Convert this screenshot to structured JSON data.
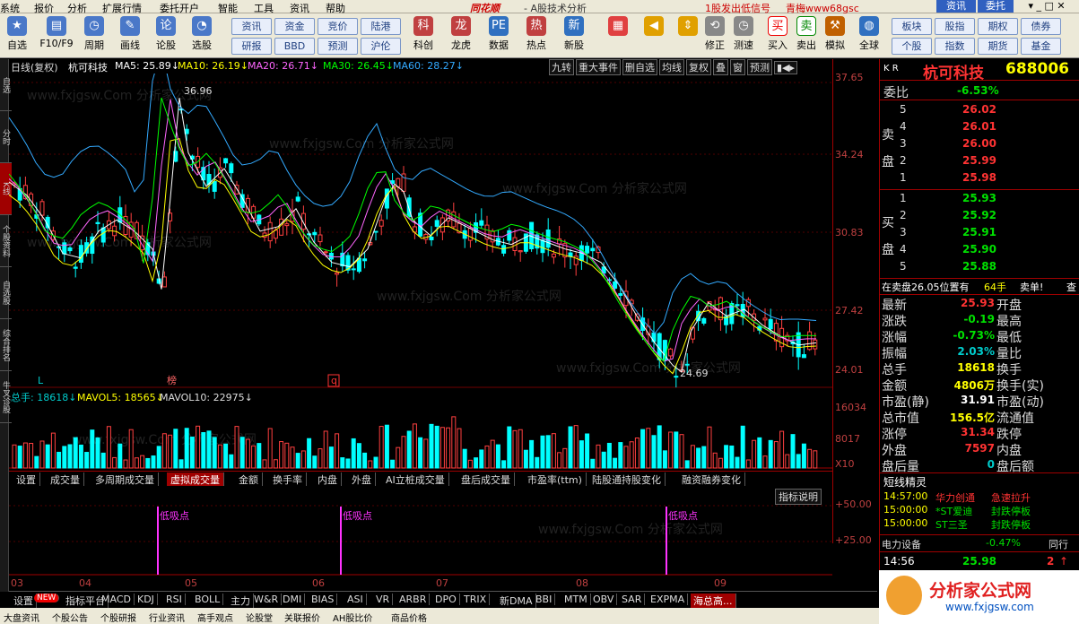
{
  "menu": {
    "items": [
      "系统",
      "报价",
      "分析",
      "扩展行情",
      "委托开户",
      "智能",
      "工具",
      "资讯",
      "帮助"
    ],
    "brand": "同花顺",
    "subtitle": "- A股技术分析",
    "promo": "1股发出低信号",
    "promo2": "青梅www68gsc",
    "btn_zixun": "资讯",
    "btn_weituo": "委托"
  },
  "toolbar": {
    "main": [
      "自选",
      "F10/F9",
      "周期",
      "画线",
      "论股",
      "选股"
    ],
    "small_row1": [
      "资讯",
      "资金",
      "竞价",
      "陆港"
    ],
    "small_row2": [
      "研报",
      "BBD",
      "预测",
      "沪伦"
    ],
    "icons2": [
      "科创",
      "龙虎",
      "数据",
      "热点",
      "新股"
    ],
    "icons3": [
      "修正",
      "测速",
      "买入",
      "卖出",
      "模拟",
      "全球"
    ],
    "right_row1": [
      "板块",
      "股指",
      "期权",
      "债券"
    ],
    "right_row2": [
      "个股",
      "指数",
      "期货",
      "基金"
    ]
  },
  "chart": {
    "period": "日线(复权)",
    "stock": "杭可科技",
    "ma5": "MA5: 25.89↓",
    "ma10": "MA10: 26.19↓",
    "ma20": "MA20: 26.71↓",
    "ma30": "MA30: 26.45↓",
    "ma60": "MA60: 28.27↓",
    "tools": [
      "九转",
      "重大事件",
      "删自选",
      "均线",
      "复权",
      "叠",
      "窗",
      "预测"
    ],
    "price_ticks": [
      "37.65",
      "34.24",
      "30.83",
      "27.42",
      "24.01"
    ],
    "high_label": "36.96",
    "low_label": "24.69",
    "marker_L": "L",
    "marker_bang": "榜",
    "marker_q": "q",
    "vol_header": {
      "a": "总手: 18618↓",
      "b": "MAVOL5: 18565↓",
      "c": "MAVOL10: 22975↓"
    },
    "vol_ticks": [
      "16034",
      "8017",
      "X10"
    ],
    "indicator_ticks": [
      "+50.00",
      "+25.00"
    ],
    "indicator_button": "指标说明",
    "signal": "低吸点",
    "months": [
      "03",
      "04",
      "05",
      "06",
      "07",
      "08",
      "09"
    ],
    "watermark": "www.fxjgsw.Com 分析家公式网"
  },
  "chart_data": {
    "type": "candlestick",
    "low": 24.69,
    "high": 36.96,
    "ylim": [
      24.01,
      37.65
    ],
    "months": [
      "03",
      "04",
      "05",
      "06",
      "07",
      "08",
      "09"
    ],
    "ma": {
      "MA5": 25.89,
      "MA10": 26.19,
      "MA20": 26.71,
      "MA30": 26.45,
      "MA60": 28.27
    },
    "volume": {
      "total": 18618,
      "MAVOL5": 18565,
      "MAVOL10": 22975
    }
  },
  "tabs": [
    "设置",
    "成交量",
    "多周期成交量",
    "虚拟成交量",
    "金额",
    "换手率",
    "内盘",
    "外盘",
    "AI立桩成交量",
    "盘后成交量",
    "市盈率(ttm)",
    "陆股通持股变化",
    "融资融券变化"
  ],
  "bottom_tabs": [
    "设置",
    "NEW",
    "指标平台",
    "MACD",
    "KDJ",
    "RSI",
    "BOLL",
    "主力",
    "W&R",
    "DMI",
    "BIAS",
    "ASI",
    "VR",
    "ARBR",
    "DPO",
    "TRIX",
    "新DMA",
    "BBI",
    "MTM",
    "OBV",
    "SAR",
    "EXPMA",
    "海总高..."
  ],
  "status": [
    "大盘资讯",
    "个股公告",
    "个股研报",
    "行业资讯",
    "高手观点",
    "论股堂",
    "关联报价",
    "AH股比价",
    "商品价格"
  ],
  "left_strip": [
    "自选",
    "分时",
    "K线",
    "个股资料",
    "自选股",
    "综合排名",
    "牛叉诊股"
  ],
  "quote": {
    "kr": "K R",
    "name": "杭可科技",
    "code": "688006",
    "weibi_label": "委比",
    "weibi": "-6.53%",
    "sell_label": "卖盘",
    "buy_label": "买盘",
    "asks": [
      {
        "n": "5",
        "p": "26.02"
      },
      {
        "n": "4",
        "p": "26.01"
      },
      {
        "n": "3",
        "p": "26.00"
      },
      {
        "n": "2",
        "p": "25.99"
      },
      {
        "n": "1",
        "p": "25.98"
      }
    ],
    "bids": [
      {
        "n": "1",
        "p": "25.93"
      },
      {
        "n": "2",
        "p": "25.92"
      },
      {
        "n": "3",
        "p": "25.91"
      },
      {
        "n": "4",
        "p": "25.90"
      },
      {
        "n": "5",
        "p": "25.88"
      }
    ],
    "ticker_a": "在卖盘26.05位置有",
    "ticker_b": "64手",
    "ticker_c": "卖单!",
    "ticker_d": "查",
    "stats": [
      {
        "l": "最新",
        "v": "25.93",
        "r": "开盘"
      },
      {
        "l": "涨跌",
        "v": "-0.19",
        "r": "最高"
      },
      {
        "l": "涨幅",
        "v": "-0.73%",
        "r": "最低"
      },
      {
        "l": "振幅",
        "v": "2.03%",
        "r": "量比"
      },
      {
        "l": "总手",
        "v": "18618",
        "r": "换手"
      },
      {
        "l": "金额",
        "v": "4806万",
        "r": "换手(实)"
      },
      {
        "l": "市盈(静)",
        "v": "31.91",
        "r": "市盈(动)"
      },
      {
        "l": "总市值",
        "v": "156.5亿",
        "r": "流通值"
      },
      {
        "l": "涨停",
        "v": "31.34",
        "r": "跌停"
      },
      {
        "l": "外盘",
        "v": "7597",
        "r": "内盘"
      },
      {
        "l": "盘后量",
        "v": "0",
        "r": "盘后额"
      }
    ],
    "short_title": "短线精灵",
    "short": [
      {
        "t": "14:57:00",
        "n": "华力创通",
        "s": "急速拉升"
      },
      {
        "t": "15:00:00",
        "n": "*ST爱迪",
        "s": "封跌停板"
      },
      {
        "t": "15:00:00",
        "n": "ST三圣",
        "s": "封跌停板"
      }
    ],
    "sector": "电力设备",
    "sector_pct": "-0.47%",
    "sector_r": "同行",
    "time": "14:56",
    "last": "25.98",
    "last_vol": "2",
    "logo": "分析家公式网",
    "logo_url": "www.fxjgsw.com"
  }
}
